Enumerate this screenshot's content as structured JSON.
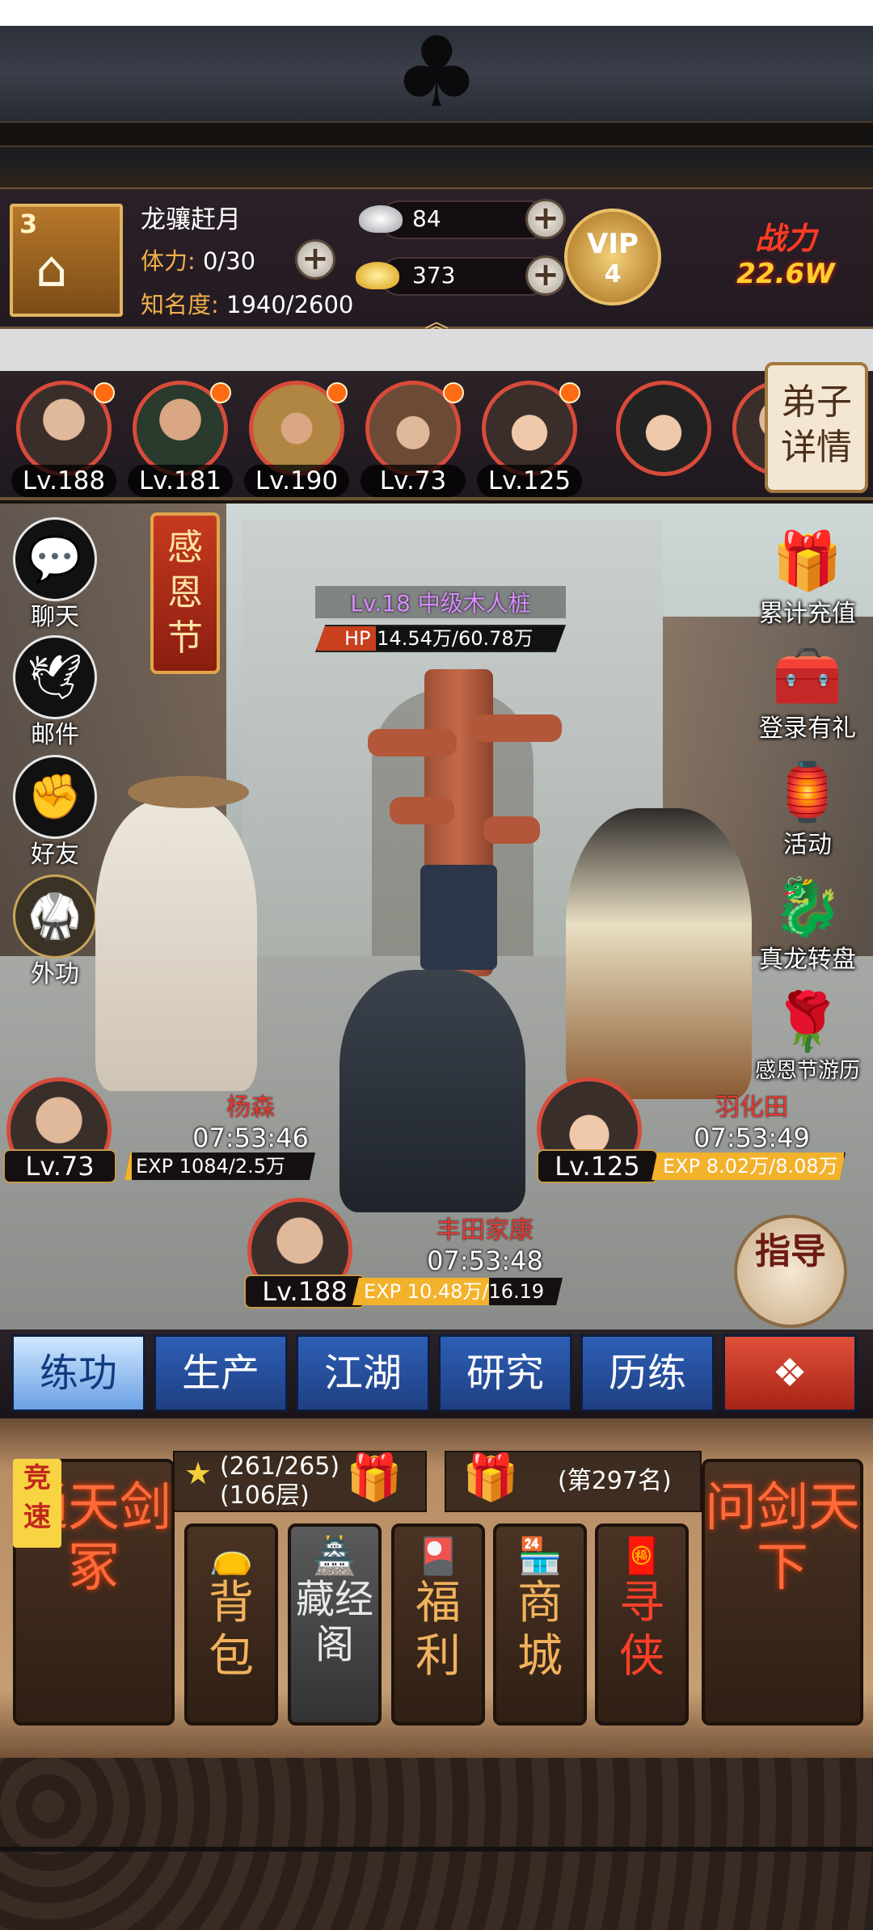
{
  "player": {
    "rank": "3",
    "name": "龙骧赶月",
    "stamina_label": "体力:",
    "stamina_value": "0/30",
    "fame_label": "知名度:",
    "fame_value": "1940/2600",
    "silver": "84",
    "gold": "373",
    "vip_text": "VIP",
    "vip_level": "4",
    "power_label": "战力",
    "power_value": "22.6W"
  },
  "disciples": [
    {
      "level": "Lv.188",
      "has_alert": true
    },
    {
      "level": "Lv.181",
      "has_alert": true
    },
    {
      "level": "Lv.190",
      "has_alert": true
    },
    {
      "level": "Lv.73",
      "has_alert": true
    },
    {
      "level": "Lv.125",
      "has_alert": true
    },
    {
      "level": "",
      "has_alert": false
    }
  ],
  "disciple_detail_label": "弟子详情",
  "left_menu": [
    {
      "label": "聊天",
      "icon": "chat-icon"
    },
    {
      "label": "邮件",
      "icon": "dove-icon"
    },
    {
      "label": "好友",
      "icon": "handshake-icon"
    },
    {
      "label": "外功",
      "icon": "martial-art-icon"
    }
  ],
  "festival_banner": "感恩节",
  "right_menu": [
    {
      "label": "累计充值",
      "icon": "gift-box-icon"
    },
    {
      "label": "登录有礼",
      "icon": "treasure-chest-icon"
    },
    {
      "label": "活动",
      "icon": "lantern-icon"
    },
    {
      "label": "真龙转盘",
      "icon": "dragon-wheel-icon"
    },
    {
      "label": "感恩节游历",
      "icon": "flower-basket-icon"
    }
  ],
  "target": {
    "name": "Lv.18 中级木人桩",
    "hp_text": "HP 14.54万/60.78万",
    "hp_fraction": 0.24
  },
  "units": [
    {
      "name": "杨森",
      "timer": "07:53:46",
      "level": "Lv.73",
      "exp": "EXP 1084/2.5万",
      "exp_fraction": 0.04
    },
    {
      "name": "羽化田",
      "timer": "07:53:49",
      "level": "Lv.125",
      "exp": "EXP 8.02万/8.08万",
      "exp_fraction": 0.99
    },
    {
      "name": "丰田家康",
      "timer": "07:53:48",
      "level": "Lv.188",
      "exp": "EXP 10.48万/16.19万",
      "exp_fraction": 0.65
    }
  ],
  "guide_label": "指导",
  "tabs": [
    {
      "label": "练功",
      "active": true
    },
    {
      "label": "生产",
      "active": false
    },
    {
      "label": "江湖",
      "active": false
    },
    {
      "label": "研究",
      "active": false
    },
    {
      "label": "历练",
      "active": false
    },
    {
      "label": "",
      "icon": "menu-grid-icon",
      "active": false
    }
  ],
  "bottom": {
    "speed_badge": "竞速",
    "tower_title": "通天剑冢",
    "tower_progress": "(261/265)",
    "tower_floor": "(106层)",
    "rank_text": "(第297名)",
    "arena_title": "问剑天下",
    "items": [
      {
        "label": "背包",
        "icon": "bag-icon"
      },
      {
        "label": "藏经阁",
        "icon": "pavilion-icon"
      },
      {
        "label": "福利",
        "icon": "gift-icon"
      },
      {
        "label": "商城",
        "icon": "shop-icon"
      },
      {
        "label": "寻侠",
        "icon": "seal-icon"
      }
    ]
  }
}
